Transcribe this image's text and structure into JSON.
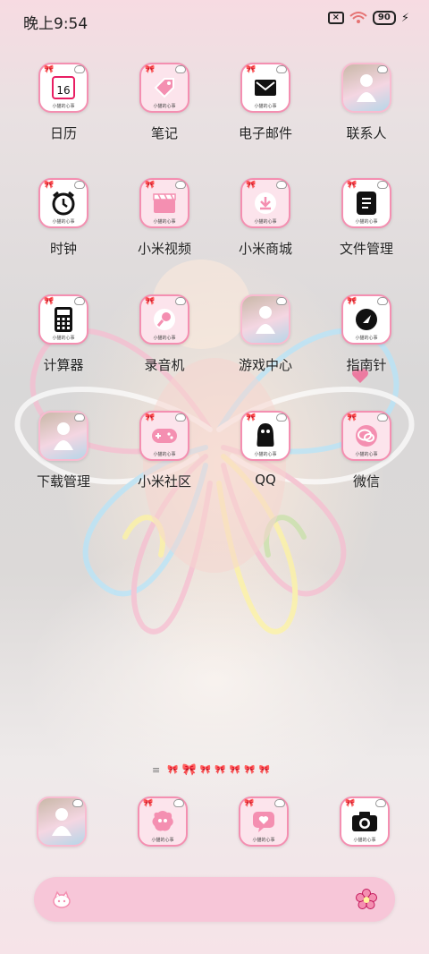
{
  "status_bar": {
    "time": "晚上9:54",
    "battery": "90"
  },
  "tile_caption": "小猫的心事",
  "apps": [
    {
      "label": "日历",
      "icon": "calendar-icon",
      "glyph": "16"
    },
    {
      "label": "笔记",
      "icon": "tag-icon"
    },
    {
      "label": "电子邮件",
      "icon": "mail-icon"
    },
    {
      "label": "联系人",
      "icon": "photo-contact-icon"
    },
    {
      "label": "时钟",
      "icon": "alarm-clock-icon"
    },
    {
      "label": "小米视频",
      "icon": "clapperboard-icon"
    },
    {
      "label": "小米商城",
      "icon": "download-icon"
    },
    {
      "label": "文件管理",
      "icon": "file-icon"
    },
    {
      "label": "计算器",
      "icon": "calculator-icon"
    },
    {
      "label": "录音机",
      "icon": "microphone-icon"
    },
    {
      "label": "游戏中心",
      "icon": "photo-game-icon"
    },
    {
      "label": "指南针",
      "icon": "compass-icon"
    },
    {
      "label": "下载管理",
      "icon": "photo-download-icon"
    },
    {
      "label": "小米社区",
      "icon": "gamepad-icon"
    },
    {
      "label": "QQ",
      "icon": "qq-penguin-icon"
    },
    {
      "label": "微信",
      "icon": "wechat-icon"
    }
  ],
  "page_indicator": {
    "pages": 8,
    "current": 1
  },
  "dock": [
    {
      "icon": "photo-dock-icon"
    },
    {
      "icon": "message-blob-icon"
    },
    {
      "icon": "heart-message-icon"
    },
    {
      "icon": "camera-icon"
    }
  ],
  "search": {
    "left_icon": "cat-paw-icon",
    "right_icon": "flower-icon"
  },
  "colors": {
    "tile_pink": "#fce4ec",
    "tile_border": "#f48fb1",
    "search_bar": "#f7c6d8"
  }
}
